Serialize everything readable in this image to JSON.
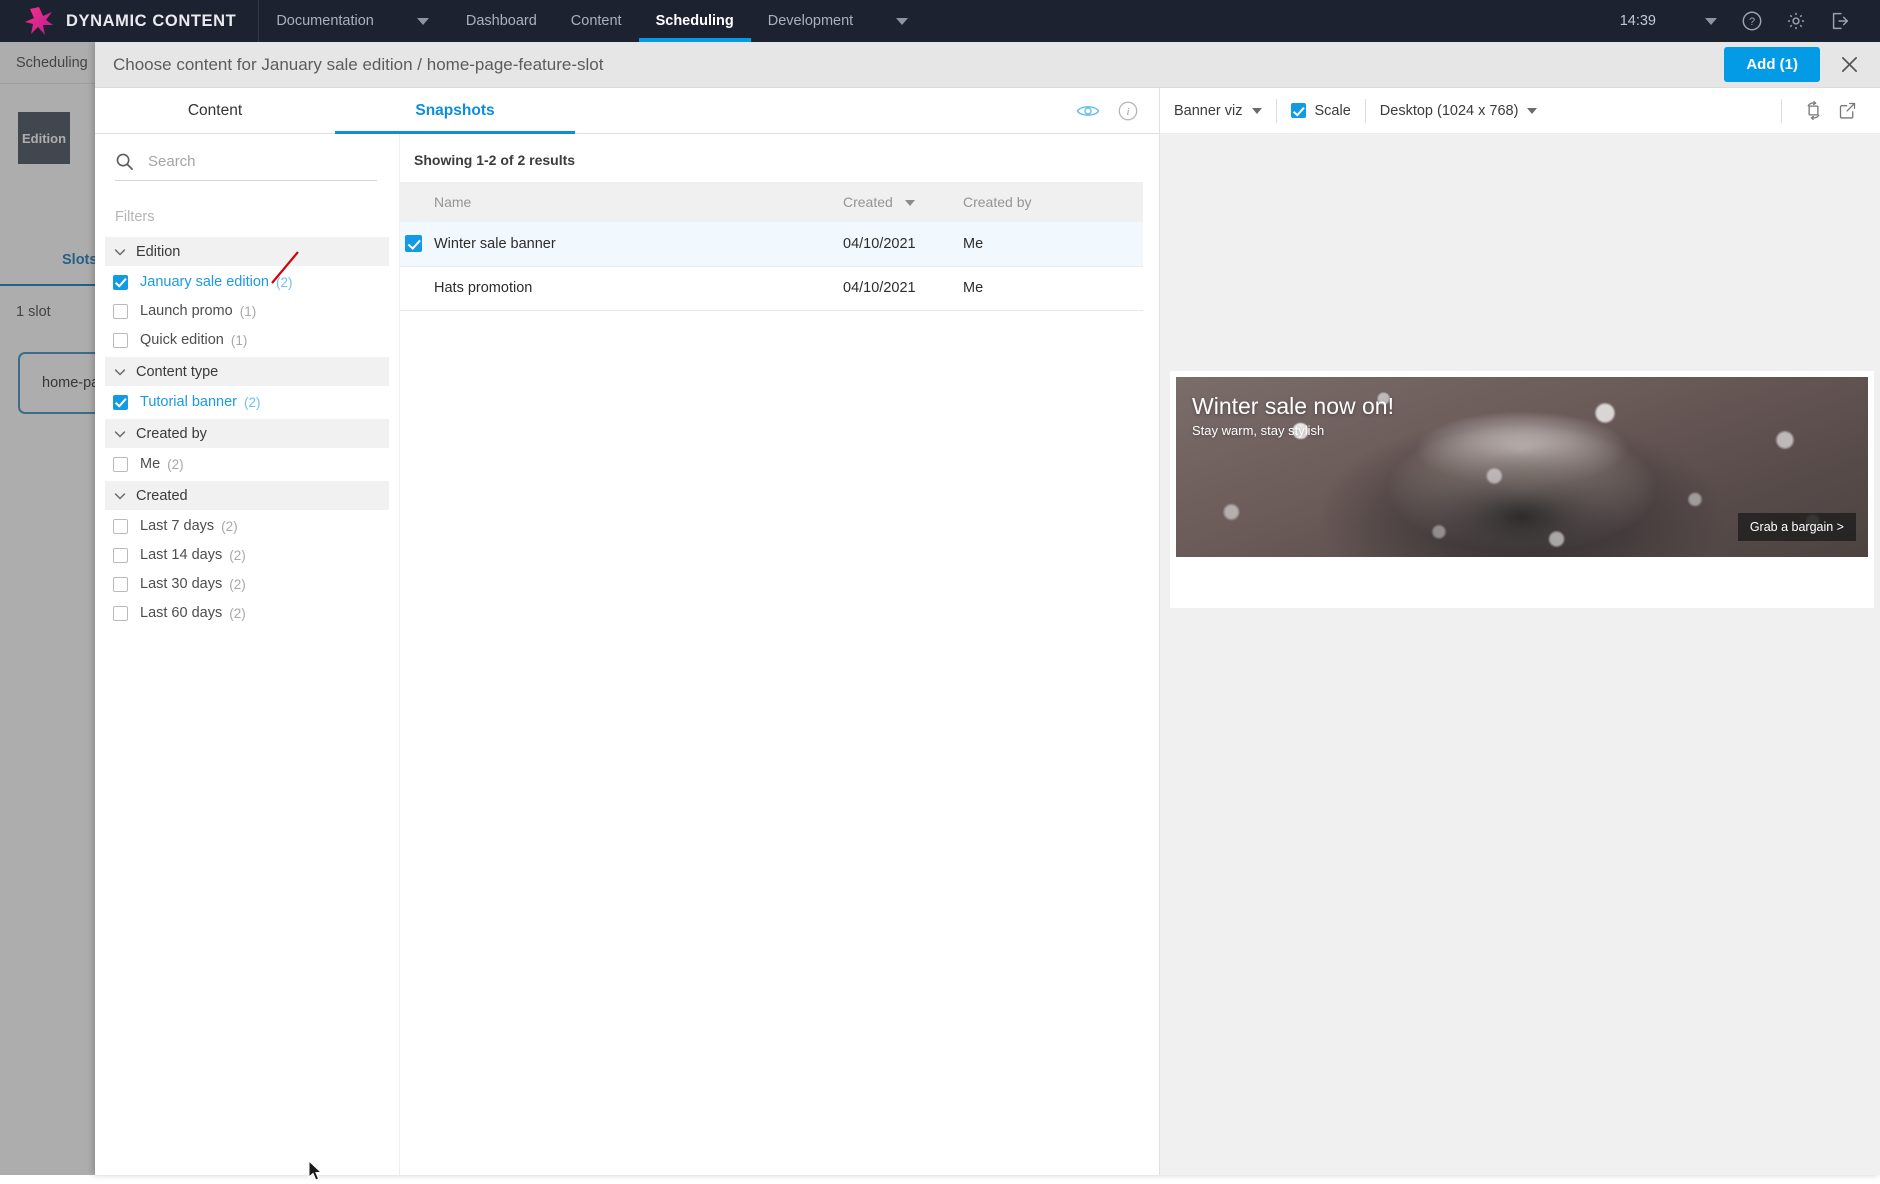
{
  "topnav": {
    "brand": "DYNAMIC CONTENT",
    "items": [
      {
        "label": "Documentation",
        "has_caret": true,
        "active": false
      },
      {
        "label": "Dashboard",
        "has_caret": false,
        "active": false
      },
      {
        "label": "Content",
        "has_caret": false,
        "active": false
      },
      {
        "label": "Scheduling",
        "has_caret": false,
        "active": true
      },
      {
        "label": "Development",
        "has_caret": false,
        "active": false
      }
    ],
    "clock": "14:39",
    "icons": [
      "chevron-down-icon",
      "help-icon",
      "gear-icon",
      "logout-icon"
    ]
  },
  "background_page": {
    "breadcrumb": "Scheduling",
    "edition_tile": "Edition",
    "slots_tab": "Slots",
    "slot_count": "1 slot",
    "slot_card": "home-page-feature-slot"
  },
  "modal": {
    "title": "Choose content for January sale edition / home-page-feature-slot",
    "add_label": "Add (1)",
    "close_icon": "close-icon",
    "tabs": [
      {
        "label": "Content",
        "active": false
      },
      {
        "label": "Snapshots",
        "active": true
      }
    ],
    "tab_icons": [
      "eye-icon",
      "info-icon"
    ]
  },
  "filters": {
    "search_placeholder": "Search",
    "search_value": "",
    "search_icon": "search-icon",
    "heading": "Filters",
    "groups": [
      {
        "title": "Edition",
        "options": [
          {
            "label": "January sale edition",
            "count": "(2)",
            "checked": true
          },
          {
            "label": "Launch promo",
            "count": "(1)",
            "checked": false
          },
          {
            "label": "Quick edition",
            "count": "(1)",
            "checked": false
          }
        ]
      },
      {
        "title": "Content type",
        "options": [
          {
            "label": "Tutorial banner",
            "count": "(2)",
            "checked": true
          }
        ]
      },
      {
        "title": "Created by",
        "options": [
          {
            "label": "Me",
            "count": "(2)",
            "checked": false
          }
        ]
      },
      {
        "title": "Created",
        "options": [
          {
            "label": "Last 7 days",
            "count": "(2)",
            "checked": false
          },
          {
            "label": "Last 14 days",
            "count": "(2)",
            "checked": false
          },
          {
            "label": "Last 30 days",
            "count": "(2)",
            "checked": false
          },
          {
            "label": "Last 60 days",
            "count": "(2)",
            "checked": false
          }
        ]
      }
    ]
  },
  "results": {
    "count_label": "Showing 1-2 of 2 results",
    "columns": [
      "Name",
      "Created",
      "Created by"
    ],
    "sorted_column": "Created",
    "rows": [
      {
        "name": "Winter sale banner",
        "created": "04/10/2021",
        "created_by": "Me",
        "checked": true
      },
      {
        "name": "Hats promotion",
        "created": "04/10/2021",
        "created_by": "Me",
        "checked": false
      }
    ]
  },
  "preview": {
    "viz_label": "Banner viz",
    "scale_label": "Scale",
    "scale_checked": true,
    "device_label": "Desktop (1024 x 768)",
    "icons": [
      "refresh-rotate-icon",
      "open-external-icon"
    ],
    "banner": {
      "heading": "Winter sale now on!",
      "subheading": "Stay warm, stay stylish",
      "cta": "Grab a bargain >"
    }
  },
  "annotation": {
    "badge": "1",
    "color": "#d3020b"
  },
  "colors": {
    "navbar_bg": "#1c2230",
    "accent_blue": "#039be5",
    "link_blue": "#1a9ae5",
    "modal_header_bg": "#e6e6e6",
    "selected_row_bg": "#f1f9fe"
  }
}
